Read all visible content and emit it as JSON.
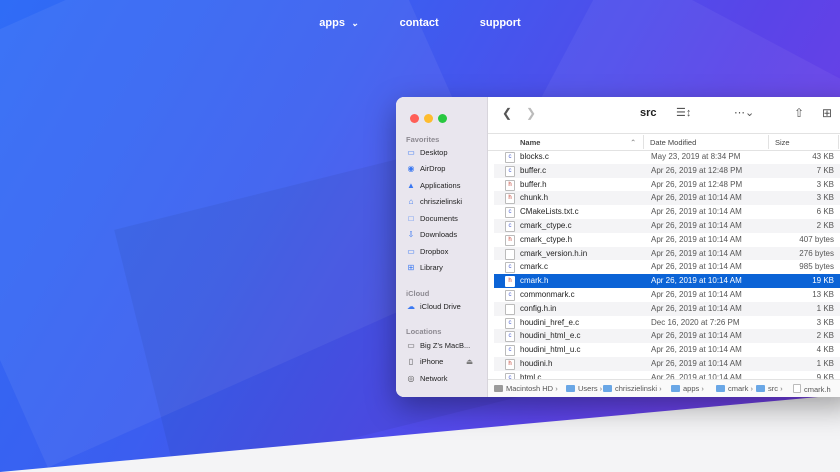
{
  "nav": {
    "apps": "apps",
    "contact": "contact",
    "support": "support"
  },
  "finder": {
    "title": "src",
    "sidebar": {
      "favorites_label": "Favorites",
      "favorites": [
        "Desktop",
        "AirDrop",
        "Applications",
        "chriszielinski",
        "Documents",
        "Downloads",
        "Dropbox",
        "Library"
      ],
      "icloud_label": "iCloud",
      "icloud": [
        "iCloud Drive"
      ],
      "locations_label": "Locations",
      "locations": [
        "Big Z's MacB...",
        "iPhone",
        "Network"
      ]
    },
    "columns": {
      "name": "Name",
      "date": "Date Modified",
      "size": "Size"
    },
    "files": [
      {
        "icon": "c",
        "name": "blocks.c",
        "date": "May 23, 2019 at 8:34 PM",
        "size": "43 KB"
      },
      {
        "icon": "c",
        "name": "buffer.c",
        "date": "Apr 26, 2019 at 12:48 PM",
        "size": "7 KB"
      },
      {
        "icon": "h",
        "name": "buffer.h",
        "date": "Apr 26, 2019 at 12:48 PM",
        "size": "3 KB"
      },
      {
        "icon": "h",
        "name": "chunk.h",
        "date": "Apr 26, 2019 at 10:14 AM",
        "size": "3 KB"
      },
      {
        "icon": "c",
        "name": "CMakeLists.txt.c",
        "date": "Apr 26, 2019 at 10:14 AM",
        "size": "6 KB"
      },
      {
        "icon": "c",
        "name": "cmark_ctype.c",
        "date": "Apr 26, 2019 at 10:14 AM",
        "size": "2 KB"
      },
      {
        "icon": "h",
        "name": "cmark_ctype.h",
        "date": "Apr 26, 2019 at 10:14 AM",
        "size": "407 bytes"
      },
      {
        "icon": "",
        "name": "cmark_version.h.in",
        "date": "Apr 26, 2019 at 10:14 AM",
        "size": "276 bytes"
      },
      {
        "icon": "c",
        "name": "cmark.c",
        "date": "Apr 26, 2019 at 10:14 AM",
        "size": "985 bytes"
      },
      {
        "icon": "h",
        "name": "cmark.h",
        "date": "Apr 26, 2019 at 10:14 AM",
        "size": "19 KB"
      },
      {
        "icon": "c",
        "name": "commonmark.c",
        "date": "Apr 26, 2019 at 10:14 AM",
        "size": "13 KB"
      },
      {
        "icon": "",
        "name": "config.h.in",
        "date": "Apr 26, 2019 at 10:14 AM",
        "size": "1 KB"
      },
      {
        "icon": "c",
        "name": "houdini_href_e.c",
        "date": "Dec 16, 2020 at 7:26 PM",
        "size": "3 KB"
      },
      {
        "icon": "c",
        "name": "houdini_html_e.c",
        "date": "Apr 26, 2019 at 10:14 AM",
        "size": "2 KB"
      },
      {
        "icon": "c",
        "name": "houdini_html_u.c",
        "date": "Apr 26, 2019 at 10:14 AM",
        "size": "4 KB"
      },
      {
        "icon": "h",
        "name": "houdini.h",
        "date": "Apr 26, 2019 at 10:14 AM",
        "size": "1 KB"
      },
      {
        "icon": "c",
        "name": "html.c",
        "date": "Apr 26, 2019 at 10:14 AM",
        "size": "9 KB"
      }
    ],
    "selected_file": "cmark.h",
    "path": [
      "Macintosh HD",
      "Users",
      "chriszielinski",
      "apps",
      "cmark",
      "src",
      "cmark.h"
    ]
  }
}
